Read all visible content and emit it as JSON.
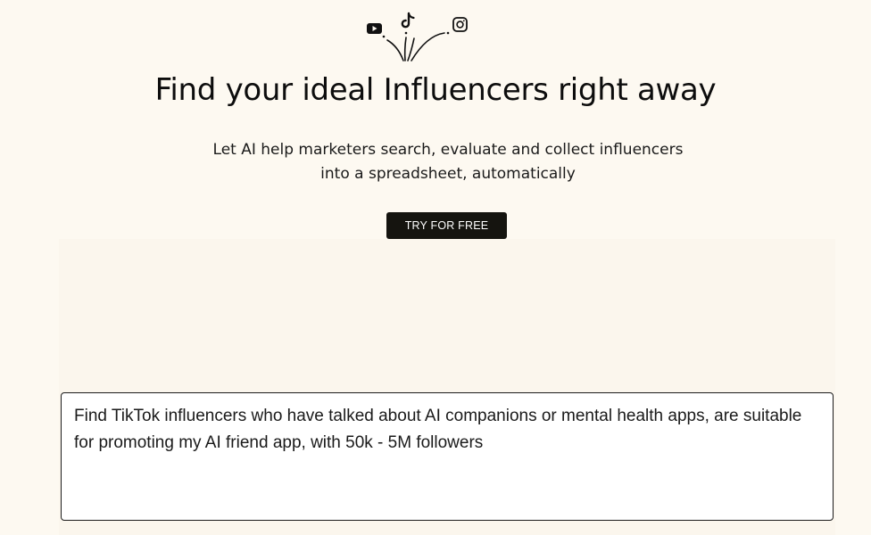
{
  "hero": {
    "icons": [
      "youtube-icon",
      "tiktok-icon",
      "instagram-icon"
    ],
    "title": "Find your ideal Influencers right away",
    "subtitle": "Let AI help marketers search, evaluate and collect influencers into a spreadsheet, automatically",
    "cta_label": "TRY FOR FREE"
  },
  "demo": {
    "prompt_value": "Find TikTok influencers who have talked about AI companions or mental health apps, are suitable for promoting my AI friend app, with 50k - 5M followers"
  },
  "colors": {
    "background": "#fdf9f1",
    "panel": "#fbf6ed",
    "button": "#15140f",
    "text": "#111111"
  }
}
